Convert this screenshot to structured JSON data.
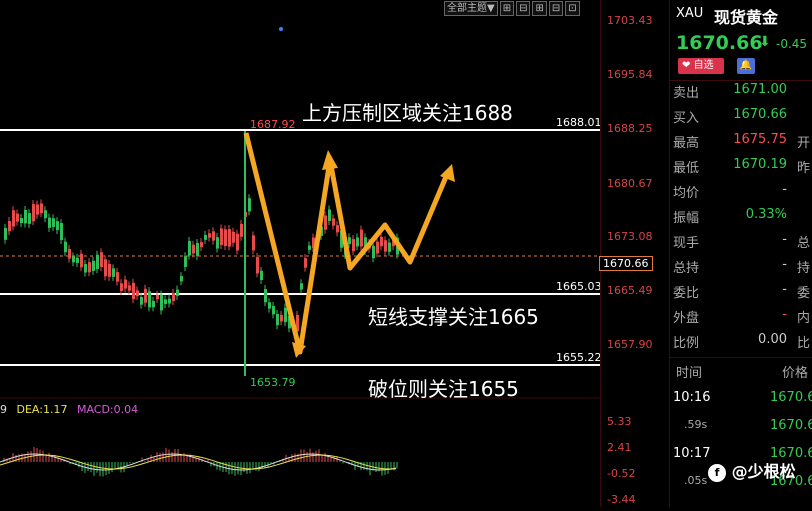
{
  "toolbar": {
    "theme_label": "全部主题▼",
    "btn1": "⊞",
    "btn2": "⊟",
    "btn3": "⊞",
    "btn4": "⊟",
    "btn5": "⊡"
  },
  "price_axis": {
    "ticks": [
      "1703.43",
      "1695.84",
      "1688.25",
      "1680.67",
      "1673.08",
      "1665.49",
      "1657.90"
    ],
    "current": "1670.66"
  },
  "levels": {
    "resistance_value": "1688.01",
    "support_value": "1665.03",
    "break_value": "1655.22",
    "high_mark": "1687.92",
    "low_mark": "1653.79"
  },
  "annotations": {
    "resistance": "上方压制区域关注1688",
    "support": "短线支撑关注1665",
    "break": "破位则关注1655"
  },
  "macd": {
    "dif_partial": "9",
    "dea": "DEA:1.17",
    "macd": "MACD:0.04",
    "ticks": [
      "5.33",
      "2.41",
      "-0.52",
      "-3.44"
    ]
  },
  "quote_panel": {
    "symbol": "XAU",
    "name": "现货黄金",
    "price": "1670.66",
    "change": "-0.45",
    "favorite_label": "自选",
    "rows": [
      {
        "k": "卖出",
        "v": "1671.00",
        "color": "#33cc55"
      },
      {
        "k": "买入",
        "v": "1670.66",
        "color": "#33cc55"
      },
      {
        "k": "最高",
        "v": "1675.75",
        "color": "#ff4d4d",
        "extra": "开"
      },
      {
        "k": "最低",
        "v": "1670.19",
        "color": "#33cc55",
        "extra": "昨"
      },
      {
        "k": "均价",
        "v": "-",
        "color": "#ccc"
      },
      {
        "k": "振幅",
        "v": "0.33%",
        "color": "#33cc55"
      },
      {
        "k": "现手",
        "v": "-",
        "color": "#ccc",
        "extra": "总"
      },
      {
        "k": "总持",
        "v": "-",
        "color": "#ccc",
        "extra": "持"
      },
      {
        "k": "委比",
        "v": "-",
        "color": "#ccc",
        "extra": "委"
      },
      {
        "k": "外盘",
        "v": "-",
        "color": "#ff4d4d",
        "extra": "内"
      },
      {
        "k": "比例",
        "v": "0.00",
        "color": "#ccc",
        "extra": "比"
      }
    ],
    "ticks_header": {
      "time": "时间",
      "price": "价格"
    },
    "tick_rows": [
      {
        "t": "10:16",
        "p": "1670.6"
      },
      {
        "t": ".59s",
        "p": "1670.6"
      },
      {
        "t": "10:17",
        "p": "1670.6"
      },
      {
        "t": ".05s",
        "p": "1670.6"
      }
    ]
  },
  "watermark": "@少根松"
}
